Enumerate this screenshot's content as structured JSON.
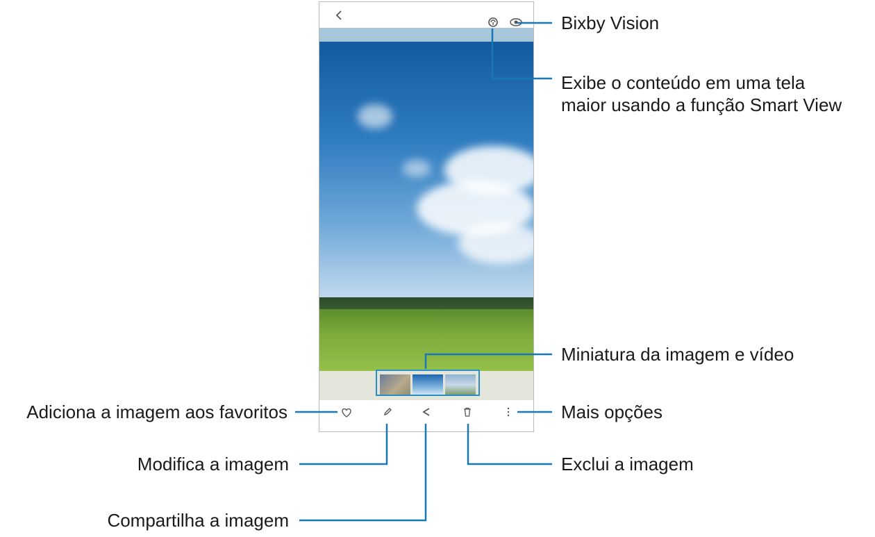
{
  "phone": {
    "icons": {
      "back": "chevron-left-icon",
      "smart_view": "smart-view-icon",
      "bixby_vision": "eye-icon",
      "favorite": "heart-icon",
      "edit": "pencil-icon",
      "share": "share-icon",
      "delete": "trash-icon",
      "more": "more-vertical-icon"
    },
    "thumbnails_count": 3
  },
  "callouts": {
    "bixby_vision": "Bixby Vision",
    "smart_view_line1": "Exibe o conteúdo em uma tela",
    "smart_view_line2": "maior usando a função Smart View",
    "thumbnails": "Miniatura da imagem e vídeo",
    "more_options": "Mais opções",
    "delete": "Exclui a imagem",
    "favorite": "Adiciona a imagem aos favoritos",
    "edit": "Modifica a imagem",
    "share": "Compartilha a imagem"
  },
  "colors": {
    "callout_line": "#1778b5",
    "thumb_highlight": "#2b8fc7"
  }
}
